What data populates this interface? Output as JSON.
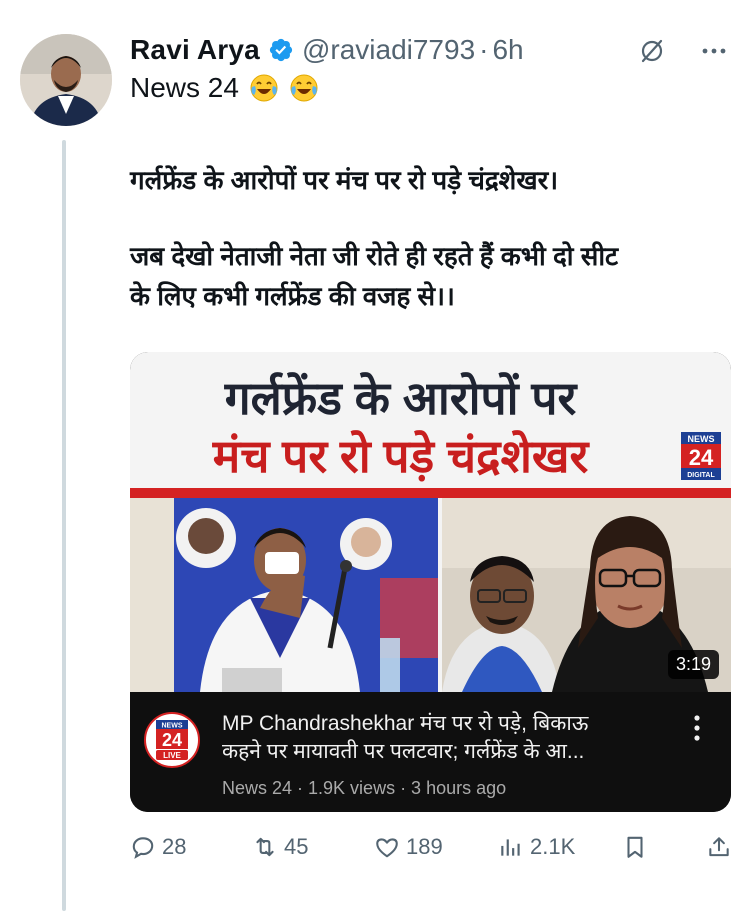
{
  "author": {
    "name": "Ravi Arya",
    "handle": "@raviadi7793",
    "separator": "·",
    "time": "6h"
  },
  "subline": {
    "text": "News 24",
    "emoji": "face-with-tears-of-joy"
  },
  "tweet": {
    "line1": "गर्लफ्रेंड के आरोपों पर मंच पर रो पड़े चंद्रशेखर।",
    "line2": "जब देखो नेताजी नेता जी रोते ही रहते हैं कभी दो सीट",
    "line3": "के लिए कभी गर्लफ्रेंड की वजह से।।"
  },
  "video": {
    "thumb_headline1": "गर्लफ्रेंड के आरोपों पर",
    "thumb_headline2": "मंच पर रो पड़े चंद्रशेखर",
    "thumb_logo_top": "NEWS",
    "thumb_logo_num": "24",
    "thumb_logo_bottom": "DIGITAL",
    "duration": "3:19",
    "title_line1": "MP Chandrashekhar मंच पर रो पड़े, बिकाऊ",
    "title_line2": "कहने पर मायावती पर पलटवार; गर्लफ्रेंड के आ...",
    "meta": "News 24 · 1.9K views · 3 hours ago",
    "channel_logo_top": "NEWS",
    "channel_logo_num": "24",
    "channel_logo_bottom": "LIVE"
  },
  "actions": {
    "replies": "28",
    "reposts": "45",
    "likes": "189",
    "views": "2.1K"
  },
  "colors": {
    "verified": "#1d9bf0",
    "muted": "#536471",
    "accent_red": "#d42222"
  }
}
